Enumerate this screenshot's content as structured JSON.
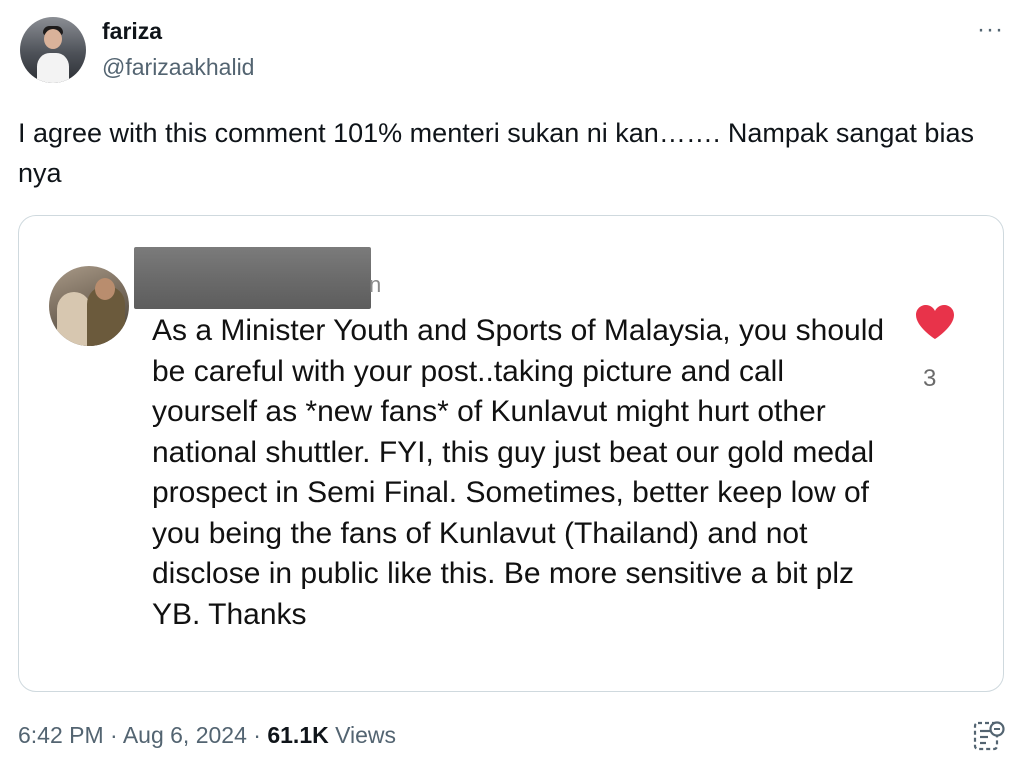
{
  "author": {
    "display_name": "fariza",
    "handle": "@farizaakhalid",
    "avatar_icon": "profile-photo"
  },
  "header": {
    "more_icon": "more-dots-icon",
    "more_label": "···"
  },
  "tweet": {
    "text": "I agree with this comment 101% menteri sukan ni kan……. Nampak sangat bias nya"
  },
  "embedded_comment": {
    "redacted_name_tail": "n",
    "text": "As a Minister Youth and Sports of Malaysia, you should be careful with your post..taking picture and call yourself as *new fans* of Kunlavut might hurt other national shuttler. FYI, this guy just beat our gold medal prospect in Semi Final. Sometimes, better keep low of you being the fans of Kunlavut (Thailand) and not disclose in public like this. Be more sensitive a bit plz YB. Thanks",
    "like_count": "3",
    "like_icon": "heart-icon",
    "heart_color": "#e8334a"
  },
  "meta": {
    "time": "6:42 PM",
    "separator": " · ",
    "date": "Aug 6, 2024",
    "views_count": "61.1K",
    "views_label": "Views",
    "analytics_icon": "analytics-icon"
  },
  "colors": {
    "text_primary": "#0f1419",
    "text_secondary": "#536471",
    "border": "#cfd9de"
  }
}
